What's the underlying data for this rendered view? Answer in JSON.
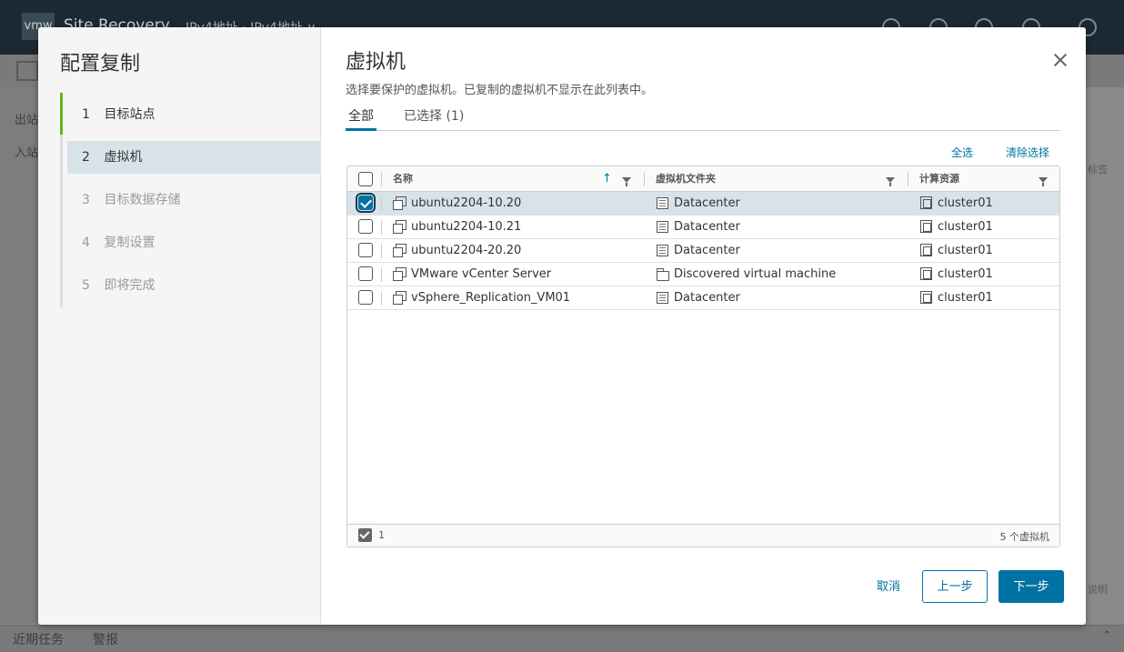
{
  "background": {
    "app_logo": "vmw",
    "app_title": "Site Recovery",
    "site_pair": "IPv4地址 · IPv4地址 ∨",
    "left_items": [
      "出站",
      "入站"
    ],
    "right_texts": [
      "标签",
      "说明"
    ],
    "footer_tabs": [
      "近期任务",
      "警报"
    ]
  },
  "wizard": {
    "title": "配置复制",
    "steps": [
      {
        "num": "1",
        "label": "目标站点",
        "state": "done"
      },
      {
        "num": "2",
        "label": "虚拟机",
        "state": "active"
      },
      {
        "num": "3",
        "label": "目标数据存储",
        "state": "pending"
      },
      {
        "num": "4",
        "label": "复制设置",
        "state": "pending"
      },
      {
        "num": "5",
        "label": "即将完成",
        "state": "pending"
      }
    ]
  },
  "page": {
    "title": "虚拟机",
    "subtitle": "选择要保护的虚拟机。已复制的虚拟机不显示在此列表中。",
    "tabs": [
      {
        "label": "全部",
        "active": true
      },
      {
        "label": "已选择 (1)",
        "active": false
      }
    ],
    "select_all": "全选",
    "clear_selection": "清除选择"
  },
  "grid": {
    "columns": [
      "名称",
      "虚拟机文件夹",
      "计算资源"
    ],
    "rows": [
      {
        "name": "ubuntu2204-10.20",
        "folder": "Datacenter",
        "folder_icon": "datacenter-icon",
        "compute": "cluster01",
        "selected": true
      },
      {
        "name": "ubuntu2204-10.21",
        "folder": "Datacenter",
        "folder_icon": "datacenter-icon",
        "compute": "cluster01",
        "selected": false
      },
      {
        "name": "ubuntu2204-20.20",
        "folder": "Datacenter",
        "folder_icon": "datacenter-icon",
        "compute": "cluster01",
        "selected": false
      },
      {
        "name": "VMware vCenter Server",
        "folder": "Discovered virtual machine",
        "folder_icon": "folder-icon",
        "compute": "cluster01",
        "selected": false
      },
      {
        "name": "vSphere_Replication_VM01",
        "folder": "Datacenter",
        "folder_icon": "datacenter-icon",
        "compute": "cluster01",
        "selected": false
      }
    ],
    "footer_selected_count": "1",
    "footer_total": "5 个虚拟机"
  },
  "buttons": {
    "cancel": "取消",
    "back": "上一步",
    "next": "下一步"
  },
  "colors": {
    "accent": "#0072a3",
    "step_done": "#61b715",
    "selected_row": "#d8e3e9"
  }
}
